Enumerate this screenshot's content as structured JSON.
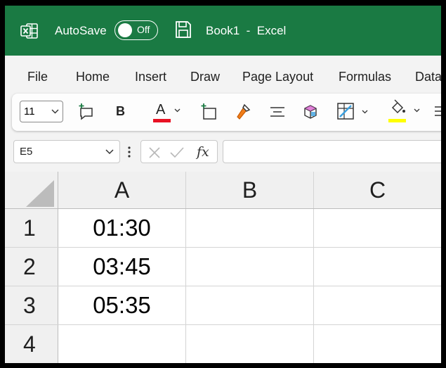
{
  "titlebar": {
    "autosave_label": "AutoSave",
    "autosave_state": "Off",
    "doc_title": "Book1  -  Excel",
    "background": "#1a7a43",
    "icons": [
      "excel-logo-icon",
      "save-icon"
    ]
  },
  "menu": {
    "items": [
      "File",
      "Home",
      "Insert",
      "Draw",
      "Page Layout",
      "Formulas",
      "Data"
    ]
  },
  "toolbar": {
    "font_size": "11",
    "bold_label": "B",
    "font_color_label": "A",
    "font_color": "#e81123",
    "fill_color": "#ffff00",
    "icons": [
      "new-comment-icon",
      "bold-icon",
      "font-color-icon",
      "insert-sheet-icon",
      "format-painter-icon",
      "align-center-icon",
      "format-cells-icon",
      "borders-icon",
      "fill-color-icon",
      "wrap-text-icon"
    ]
  },
  "formula_bar": {
    "name_box": "E5",
    "fx_label": "fx",
    "formula": ""
  },
  "grid": {
    "columns": [
      "A",
      "B",
      "C"
    ],
    "rows": [
      "1",
      "2",
      "3",
      "4"
    ],
    "cells": [
      [
        "01:30",
        "",
        ""
      ],
      [
        "03:45",
        "",
        ""
      ],
      [
        "05:35",
        "",
        ""
      ],
      [
        "",
        "",
        ""
      ]
    ]
  }
}
